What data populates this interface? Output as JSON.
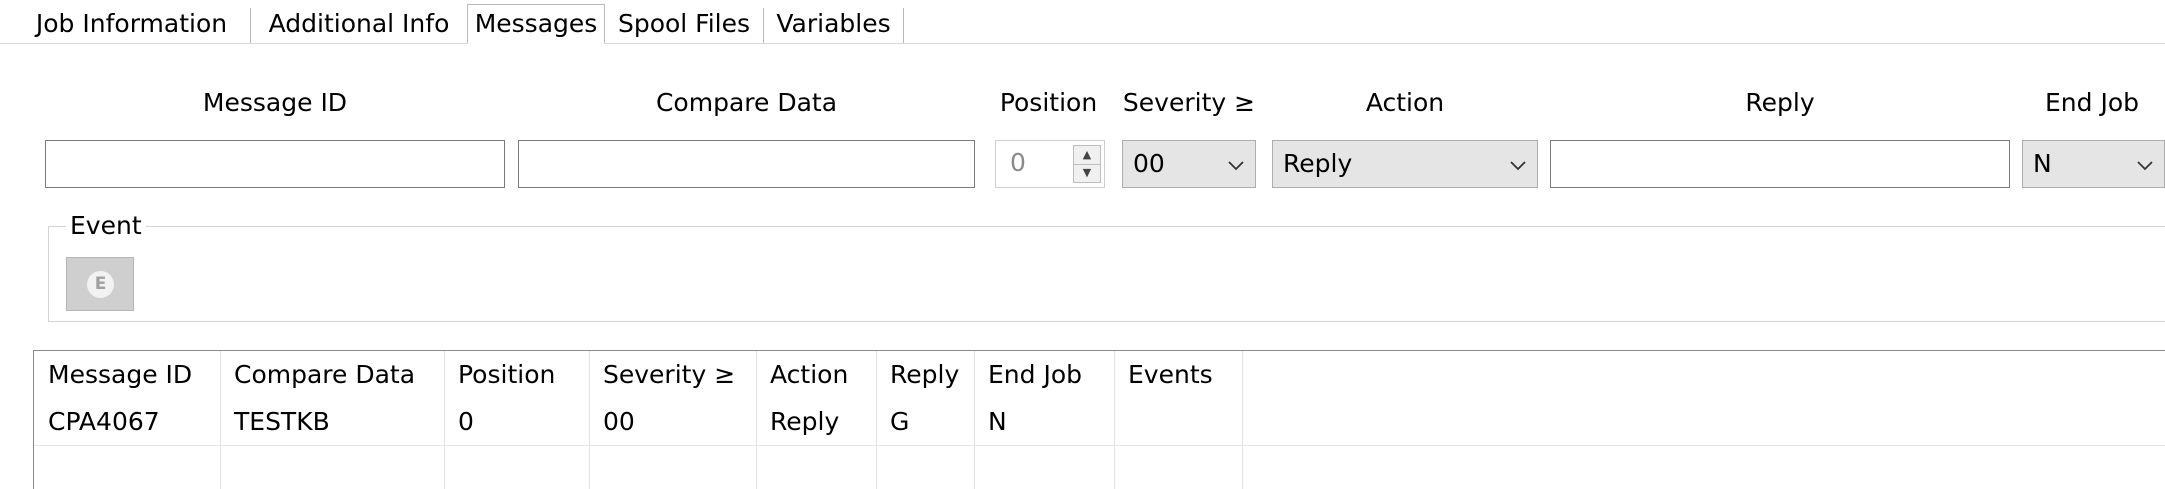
{
  "tabs": [
    {
      "label": "Job Information"
    },
    {
      "label": "Additional Info"
    },
    {
      "label": "Messages",
      "active": true
    },
    {
      "label": "Spool Files"
    },
    {
      "label": "Variables"
    }
  ],
  "form": {
    "labels": {
      "message_id": "Message ID",
      "compare_data": "Compare Data",
      "position": "Position",
      "severity": "Severity ≥",
      "action": "Action",
      "reply": "Reply",
      "end_job": "End Job"
    },
    "message_id_value": "",
    "compare_data_value": "",
    "position_value": "0",
    "severity_value": "00",
    "action_value": "Reply",
    "reply_value": "",
    "end_job_value": "N"
  },
  "event_group": {
    "title": "Event",
    "button_letter": "E"
  },
  "table": {
    "headers": [
      "Message ID",
      "Compare Data",
      "Position",
      "Severity ≥",
      "Action",
      "Reply",
      "End Job",
      "Events"
    ],
    "rows": [
      [
        "CPA4067",
        "TESTKB",
        "0",
        "00",
        "Reply",
        "G",
        "N",
        ""
      ]
    ]
  },
  "colors": {
    "border": "#7a7a7a",
    "combo_bg": "#e5e5e5",
    "disabled_text": "#8a8a8a"
  },
  "icons": {
    "spinner_up": "chevron-up-icon",
    "spinner_down": "chevron-down-icon",
    "combo_arrow": "chevron-down-icon",
    "event": "event-e-icon"
  }
}
